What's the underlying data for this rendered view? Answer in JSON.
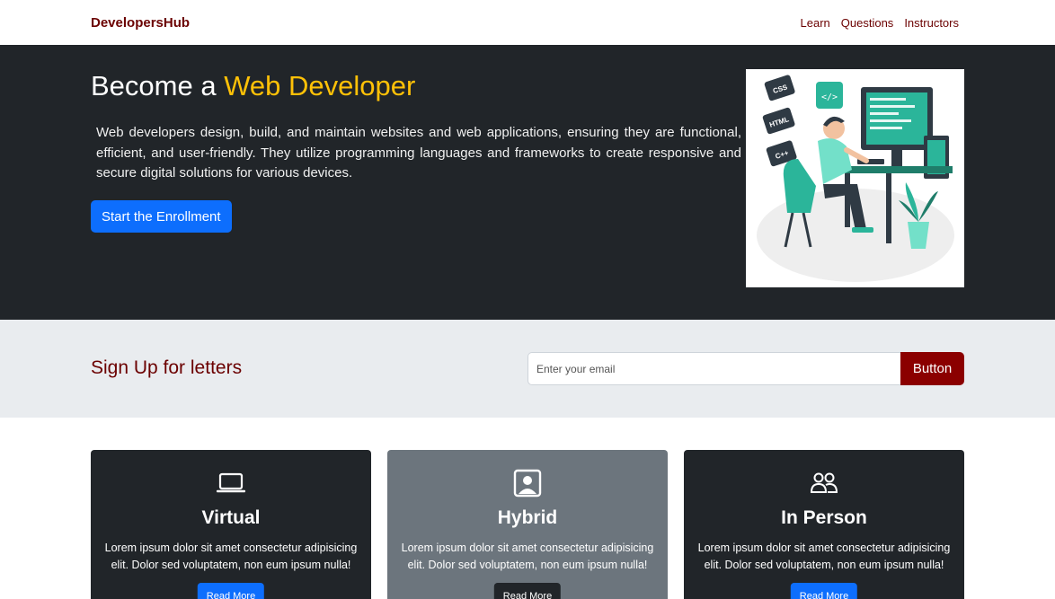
{
  "navbar": {
    "brand": "DevelopersHub",
    "links": [
      "Learn",
      "Questions",
      "Instructors"
    ]
  },
  "hero": {
    "title_prefix": "Become a ",
    "title_accent": "Web Developer",
    "text": "Web developers design, build, and maintain websites and web applications, ensuring they are functional, efficient, and user-friendly. They utilize programming languages and frameworks to create responsive and secure digital solutions for various devices.",
    "button": "Start the Enrollment",
    "illustration_labels": [
      "CSS",
      "HTML",
      "C++"
    ]
  },
  "newsletter": {
    "title": "Sign Up for letters",
    "placeholder": "Enter your email",
    "button": "Button"
  },
  "cards": [
    {
      "icon": "laptop-icon",
      "title": "Virtual",
      "text": "Lorem ipsum dolor sit amet consectetur adipisicing elit. Dolor sed voluptatem, non eum ipsum nulla!",
      "button": "Read More"
    },
    {
      "icon": "person-badge-icon",
      "title": "Hybrid",
      "text": "Lorem ipsum dolor sit amet consectetur adipisicing elit. Dolor sed voluptatem, non eum ipsum nulla!",
      "button": "Read More"
    },
    {
      "icon": "people-icon",
      "title": "In Person",
      "text": "Lorem ipsum dolor sit amet consectetur adipisicing elit. Dolor sed voluptatem, non eum ipsum nulla!",
      "button": "Read More"
    }
  ],
  "colors": {
    "brand": "#6b0000",
    "hero_bg": "#212529",
    "accent": "#ffc107",
    "primary": "#0d6efd",
    "newsletter_bg": "#e9ecef",
    "newsletter_button": "#8b0000",
    "card_secondary": "#6c757d",
    "illustration_green": "#2bb59a"
  }
}
